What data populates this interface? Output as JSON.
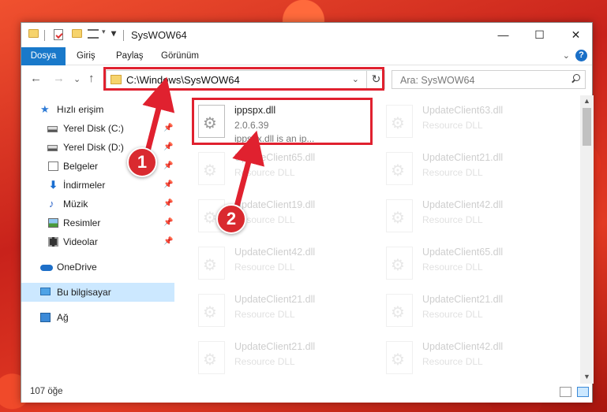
{
  "window": {
    "title": "SysWOW64",
    "minimize": "—",
    "maximize": "☐",
    "close": "✕"
  },
  "ribbon": {
    "tabs": [
      "Dosya",
      "Giriş",
      "Paylaş",
      "Görünüm"
    ],
    "expand": "⌄",
    "help": "?"
  },
  "nav": {
    "back": "←",
    "forward": "→",
    "recent": "⌄",
    "up": "↑",
    "address": "C:\\Windows\\SysWOW64",
    "address_dropdown": "⌄",
    "refresh": "↻",
    "search_placeholder": "Ara: SysWOW64"
  },
  "sidebar": {
    "items": [
      {
        "label": "Hızlı erişim",
        "icon": "star-icon"
      },
      {
        "label": "Yerel Disk (C:)",
        "icon": "drive-icon",
        "pinned": true
      },
      {
        "label": "Yerel Disk (D:)",
        "icon": "drive-icon",
        "pinned": true
      },
      {
        "label": "Belgeler",
        "icon": "documents-icon",
        "pinned": true
      },
      {
        "label": "İndirmeler",
        "icon": "download-icon",
        "pinned": true
      },
      {
        "label": "Müzik",
        "icon": "music-icon",
        "pinned": true
      },
      {
        "label": "Resimler",
        "icon": "pictures-icon",
        "pinned": true
      },
      {
        "label": "Videolar",
        "icon": "videos-icon",
        "pinned": true
      },
      {
        "label": "OneDrive",
        "icon": "cloud-icon"
      },
      {
        "label": "Bu bilgisayar",
        "icon": "computer-icon",
        "selected": true
      },
      {
        "label": "Ağ",
        "icon": "network-icon"
      }
    ],
    "pin_glyph": "📌"
  },
  "files": {
    "highlighted": {
      "name": "ippspx.dll",
      "version": "2.0.6.39",
      "description": "ippspx.dll is an ip..."
    },
    "left_column": [
      {
        "name": "UpdateClient65.dll",
        "type": "Resource DLL"
      },
      {
        "name": "UpdateClient19.dll",
        "type": "Resource DLL"
      },
      {
        "name": "UpdateClient42.dll",
        "type": "Resource DLL"
      },
      {
        "name": "UpdateClient21.dll",
        "type": "Resource DLL"
      },
      {
        "name": "UpdateClient21.dll",
        "type": "Resource DLL"
      }
    ],
    "right_column": [
      {
        "name": "UpdateClient63.dll",
        "type": "Resource DLL"
      },
      {
        "name": "UpdateClient21.dll",
        "type": "Resource DLL"
      },
      {
        "name": "UpdateClient42.dll",
        "type": "Resource DLL"
      },
      {
        "name": "UpdateClient65.dll",
        "type": "Resource DLL"
      },
      {
        "name": "UpdateClient21.dll",
        "type": "Resource DLL"
      },
      {
        "name": "UpdateClient42.dll",
        "type": "Resource DLL"
      }
    ]
  },
  "status": {
    "item_count": "107 öğe"
  },
  "annotations": {
    "callout_1": "1",
    "callout_2": "2",
    "highlight_color": "#e0212f"
  },
  "colors": {
    "accent": "#1979ca",
    "selection": "#cce8ff"
  }
}
